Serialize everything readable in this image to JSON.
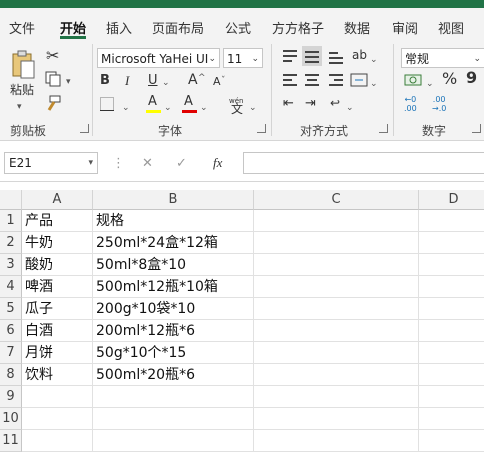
{
  "tabs": [
    "文件",
    "开始",
    "插入",
    "页面布局",
    "公式",
    "方方格子",
    "数据",
    "审阅",
    "视图"
  ],
  "active_tab": "开始",
  "ribbon": {
    "paste_label": "粘贴",
    "groups": {
      "clipboard": "剪贴板",
      "font": "字体",
      "alignment": "对齐方式",
      "number": "数字"
    },
    "font_name": "Microsoft YaHei UI",
    "font_size": "11",
    "number_format": "常规",
    "bold_label": "B",
    "italic_label": "I",
    "underline_label": "U",
    "grow_font": "A",
    "shrink_font": "A",
    "font_color_label": "A",
    "highlight_label": "A",
    "wen_label": "wén",
    "wen_char": "文",
    "percent_label": "%",
    "comma_label": "9"
  },
  "formula_bar": {
    "name_box": "E21",
    "fx_label": "fx",
    "cancel": "✕",
    "confirm": "✓",
    "value": ""
  },
  "sheet": {
    "columns": [
      "A",
      "B",
      "C",
      "D"
    ],
    "rows": [
      {
        "n": "1",
        "A": "产品",
        "B": "规格"
      },
      {
        "n": "2",
        "A": "牛奶",
        "B": "250ml*24盒*12箱"
      },
      {
        "n": "3",
        "A": "酸奶",
        "B": "50ml*8盒*10"
      },
      {
        "n": "4",
        "A": "啤酒",
        "B": "500ml*12瓶*10箱"
      },
      {
        "n": "5",
        "A": "瓜子",
        "B": "200g*10袋*10"
      },
      {
        "n": "6",
        "A": "白酒",
        "B": "200ml*12瓶*6"
      },
      {
        "n": "7",
        "A": "月饼",
        "B": "50g*10个*15"
      },
      {
        "n": "8",
        "A": "饮料",
        "B": "500ml*20瓶*6"
      },
      {
        "n": "9",
        "A": "",
        "B": ""
      },
      {
        "n": "10",
        "A": "",
        "B": ""
      },
      {
        "n": "11",
        "A": "",
        "B": ""
      }
    ]
  },
  "colors": {
    "accent": "#217346",
    "font_color": "#e00000",
    "highlight": "#ffff00"
  }
}
